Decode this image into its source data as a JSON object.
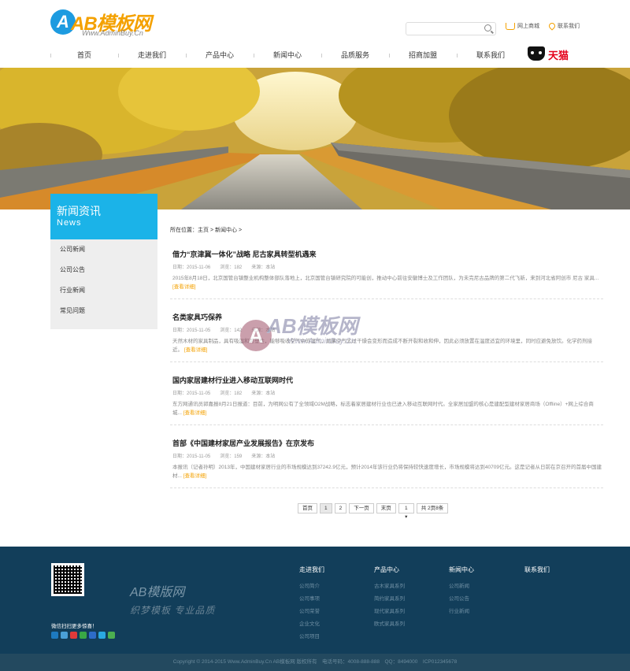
{
  "header": {
    "logo_mark": "A",
    "logo_text": "AB模板网",
    "logo_sub": "Www.AdminBuy.Cn",
    "search_placeholder": "",
    "shop_label": "网上商城",
    "location_label": "联系我们"
  },
  "nav": {
    "items": [
      "首页",
      "走进我们",
      "产品中心",
      "新闻中心",
      "品质服务",
      "招商加盟",
      "联系我们"
    ],
    "tmall_label": "天猫"
  },
  "sidebar": {
    "title": "新闻资讯",
    "title_en": "News",
    "items": [
      "公司新闻",
      "公司公告",
      "行业新闻",
      "常见问题"
    ]
  },
  "breadcrumb": {
    "prefix": "所在位置：",
    "home": "主页",
    "current": "新闻中心",
    "sep": ">"
  },
  "articles": [
    {
      "title": "借力“京津冀一体化”战略 尼古家具转型机遇来",
      "meta": "日期：2015-11-06　　浏览：182　　来源：本站",
      "desc": "2015年8月18日，北京国管台镇整业机构整体部队落地上，北京国管台镇研究院的可能创，推动中心前往安徽博士及工作团队，为未完尼古品牌的第二代飞新，来到河北省阿创市 尼古 家具...",
      "more": "[查看详细]"
    },
    {
      "title": "名类家具巧保养",
      "meta": "日期：2015-11-05　　浏览：142　　来源：本站",
      "desc": "天然木材的家具制品，具有吸湿和可塑性，能够吸收空气中的湿气，如果空气太过干燥会变形而造成不断开裂和收和伸，因此必须放置在温度适宜的环境里，同时应避免放饮。化学药剂接近。",
      "more": "[查看详细]"
    },
    {
      "title": "国内家居建材行业进入移动互联网时代",
      "meta": "日期：2015-11-05　　浏览：182　　来源：本站",
      "desc": "东方网通讯员郭嘉报8月21日报道：目前，为明网公有了全领域O2M战略，标志着家居建材行业也已进入移动互联网时代。全家居加盟的核心是建配型建材家居商场（Offline）+网上综合商城...",
      "more": "[查看详细]"
    },
    {
      "title": "首部《中国建材家居产业发展报告》在京发布",
      "meta": "日期：2015-11-05　　浏览：159　　来源：本站",
      "desc": "本报讯（记者孙明）2013年，中国建材家居行业的市场规模达到37242.9亿元，预计2014年该行业仍将保持较快速度增长，市场规模将达到40709亿元。这是记者从日前在京召开的首届中国建材...",
      "more": "[查看详细]"
    }
  ],
  "pager": {
    "first": "首页",
    "pages": [
      "1",
      "2"
    ],
    "next": "下一页",
    "last": "末页",
    "select_value": "1",
    "info": "共 2页8条"
  },
  "footer": {
    "qr_caption": "微信扫扫更多惊喜！",
    "brand": "AB模版网",
    "slogan": "织梦模板 专业品质",
    "columns": [
      {
        "title": "走进我们",
        "items": [
          "公司简介",
          "公司事项",
          "公司荣誉",
          "企业文化",
          "公司项目"
        ]
      },
      {
        "title": "产品中心",
        "items": [
          "古木家具系列",
          "简约家具系列",
          "现代家具系列",
          "欧式家具系列"
        ]
      },
      {
        "title": "新闻中心",
        "items": [
          "公司新闻",
          "公司公告",
          "行业新闻"
        ]
      },
      {
        "title": "联系我们",
        "items": []
      }
    ],
    "copyright": "Copyright © 2014-2015 Www.AdminBuy.Cn AB模板网 版权所有　电话号码：4008-888-888　QQ：8494000　ICP012345678"
  },
  "watermark": {
    "mark": "A",
    "text": "AB模板网",
    "sub": "Www.AdminBuy.Cn"
  },
  "colors": {
    "accent": "#1bb3e8",
    "brand_orange": "#f4a100",
    "footer_bg": "#123e5a",
    "social": [
      "#1d7ac0",
      "#4aa0d8",
      "#e03a3a",
      "#39a845",
      "#2d6cc8",
      "#2aa8e0",
      "#4caf50"
    ]
  }
}
